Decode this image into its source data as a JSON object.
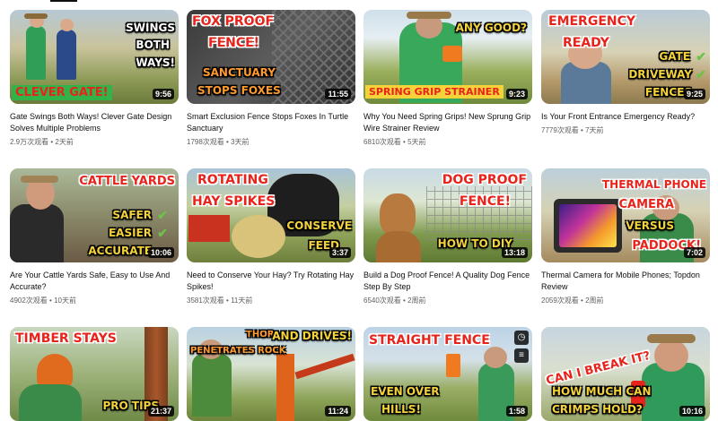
{
  "videos": [
    {
      "title": "Gate Swings Both Ways! Clever Gate Design Solves Multiple Problems",
      "views": "2.9万次观看",
      "age": "2天前",
      "duration": "9:56",
      "captions": [
        "SWINGS",
        "BOTH",
        "WAYS!",
        "CLEVER GATE!"
      ]
    },
    {
      "title": "Smart Exclusion Fence Stops Foxes In Turtle Sanctuary",
      "views": "1798次观看",
      "age": "3天前",
      "duration": "11:55",
      "captions": [
        "FOX PROOF",
        "FENCE!",
        "SANCTUARY",
        "STOPS FOXES"
      ]
    },
    {
      "title": "Why You Need Spring Grips! New Sprung Grip Wire Strainer Review",
      "views": "6810次观看",
      "age": "5天前",
      "duration": "9:23",
      "captions": [
        "ANY GOOD?",
        "SPRING GRIP STRAINER"
      ]
    },
    {
      "title": "Is Your Front Entrance Emergency Ready?",
      "views": "7779次观看",
      "age": "7天前",
      "duration": "9:25",
      "captions": [
        "EMERGENCY",
        "READY",
        "GATE",
        "DRIVEWAY",
        "FENCES"
      ]
    },
    {
      "title": "Are Your Cattle Yards Safe, Easy to Use And Accurate?",
      "views": "4902次观看",
      "age": "10天前",
      "duration": "10:06",
      "captions": [
        "CATTLE YARDS",
        "SAFER",
        "EASIER",
        "ACCURATE"
      ]
    },
    {
      "title": "Need to Conserve Your Hay? Try Rotating Hay Spikes!",
      "views": "3581次观看",
      "age": "11天前",
      "duration": "3:37",
      "captions": [
        "ROTATING",
        "HAY SPIKES",
        "CONSERVE",
        "FEED"
      ]
    },
    {
      "title": "Build a Dog Proof Fence! A Quality Dog Fence Step By Step",
      "views": "6540次观看",
      "age": "2周前",
      "duration": "13:18",
      "captions": [
        "DOG PROOF",
        "FENCE!",
        "HOW TO DIY"
      ]
    },
    {
      "title": "Thermal Camera for Mobile Phones; Topdon Review",
      "views": "2059次观看",
      "age": "2周前",
      "duration": "7:02",
      "captions": [
        "THERMAL PHONE",
        "CAMERA",
        "VERSUS",
        "PADDOCK!"
      ]
    },
    {
      "title": "",
      "views": "",
      "age": "",
      "duration": "21:37",
      "captions": [
        "TIMBER STAYS",
        "PRO TIPS"
      ]
    },
    {
      "title": "",
      "views": "",
      "age": "",
      "duration": "11:24",
      "captions": [
        "THOR",
        "PENETRATES ROCK",
        "AND DRIVES!"
      ]
    },
    {
      "title": "",
      "views": "",
      "age": "",
      "duration": "1:58",
      "captions": [
        "STRAIGHT FENCE",
        "EVEN OVER",
        "HILLS!"
      ]
    },
    {
      "title": "",
      "views": "",
      "age": "",
      "duration": "10:16",
      "captions": [
        "CAN I BREAK IT?",
        "HOW MUCH CAN",
        "CRIMPS HOLD?"
      ]
    }
  ],
  "separator": "•",
  "icons": {
    "clock": "clock-icon",
    "queue": "add-to-queue-icon"
  },
  "colors": {
    "accent_green": "#6cc24a",
    "caption_red": "#e8231b",
    "text_primary": "#0f0f0f",
    "text_secondary": "#606060"
  }
}
